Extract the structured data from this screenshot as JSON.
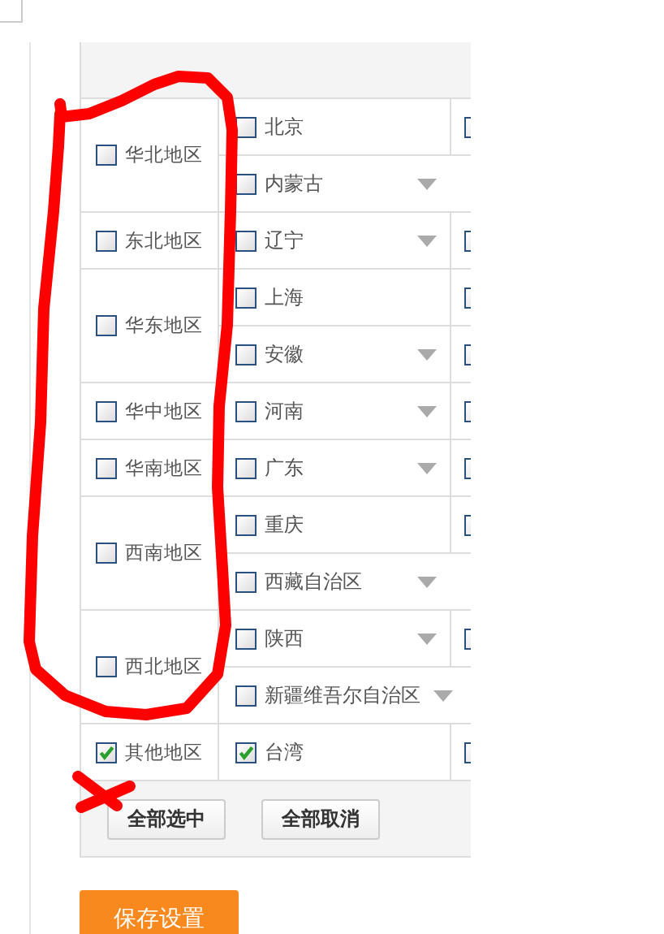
{
  "regions": [
    {
      "name": "华北地区",
      "checked": false,
      "provinces": [
        {
          "name": "北京",
          "checked": false,
          "expandable": false,
          "next_checkbox": {
            "checked": false
          }
        },
        {
          "name": "内蒙古",
          "checked": false,
          "expandable": true
        }
      ]
    },
    {
      "name": "东北地区",
      "checked": false,
      "provinces": [
        {
          "name": "辽宁",
          "checked": false,
          "expandable": true,
          "next_checkbox": {
            "checked": false
          }
        }
      ]
    },
    {
      "name": "华东地区",
      "checked": false,
      "provinces": [
        {
          "name": "上海",
          "checked": false,
          "expandable": false,
          "next_checkbox": {
            "checked": false
          }
        },
        {
          "name": "安徽",
          "checked": false,
          "expandable": true,
          "next_checkbox": {
            "checked": false
          }
        }
      ]
    },
    {
      "name": "华中地区",
      "checked": false,
      "provinces": [
        {
          "name": "河南",
          "checked": false,
          "expandable": true,
          "next_checkbox": {
            "checked": false
          }
        }
      ]
    },
    {
      "name": "华南地区",
      "checked": false,
      "provinces": [
        {
          "name": "广东",
          "checked": false,
          "expandable": true,
          "next_checkbox": {
            "checked": false
          }
        }
      ]
    },
    {
      "name": "西南地区",
      "checked": false,
      "provinces": [
        {
          "name": "重庆",
          "checked": false,
          "expandable": false,
          "next_checkbox": {
            "checked": false
          }
        },
        {
          "name": "西藏自治区",
          "checked": false,
          "expandable": true
        }
      ]
    },
    {
      "name": "西北地区",
      "checked": false,
      "provinces": [
        {
          "name": "陕西",
          "checked": false,
          "expandable": true,
          "next_checkbox": {
            "checked": false
          }
        },
        {
          "name": "新疆维吾尔自治区",
          "checked": false,
          "expandable": true
        }
      ]
    },
    {
      "name": "其他地区",
      "checked": true,
      "provinces": [
        {
          "name": "台湾",
          "checked": true,
          "expandable": false,
          "next_checkbox": {
            "checked": false
          }
        }
      ]
    }
  ],
  "buttons": [
    {
      "label": "全部选中"
    },
    {
      "label": "全部取消"
    }
  ],
  "save_button": {
    "label": "保存设置"
  }
}
